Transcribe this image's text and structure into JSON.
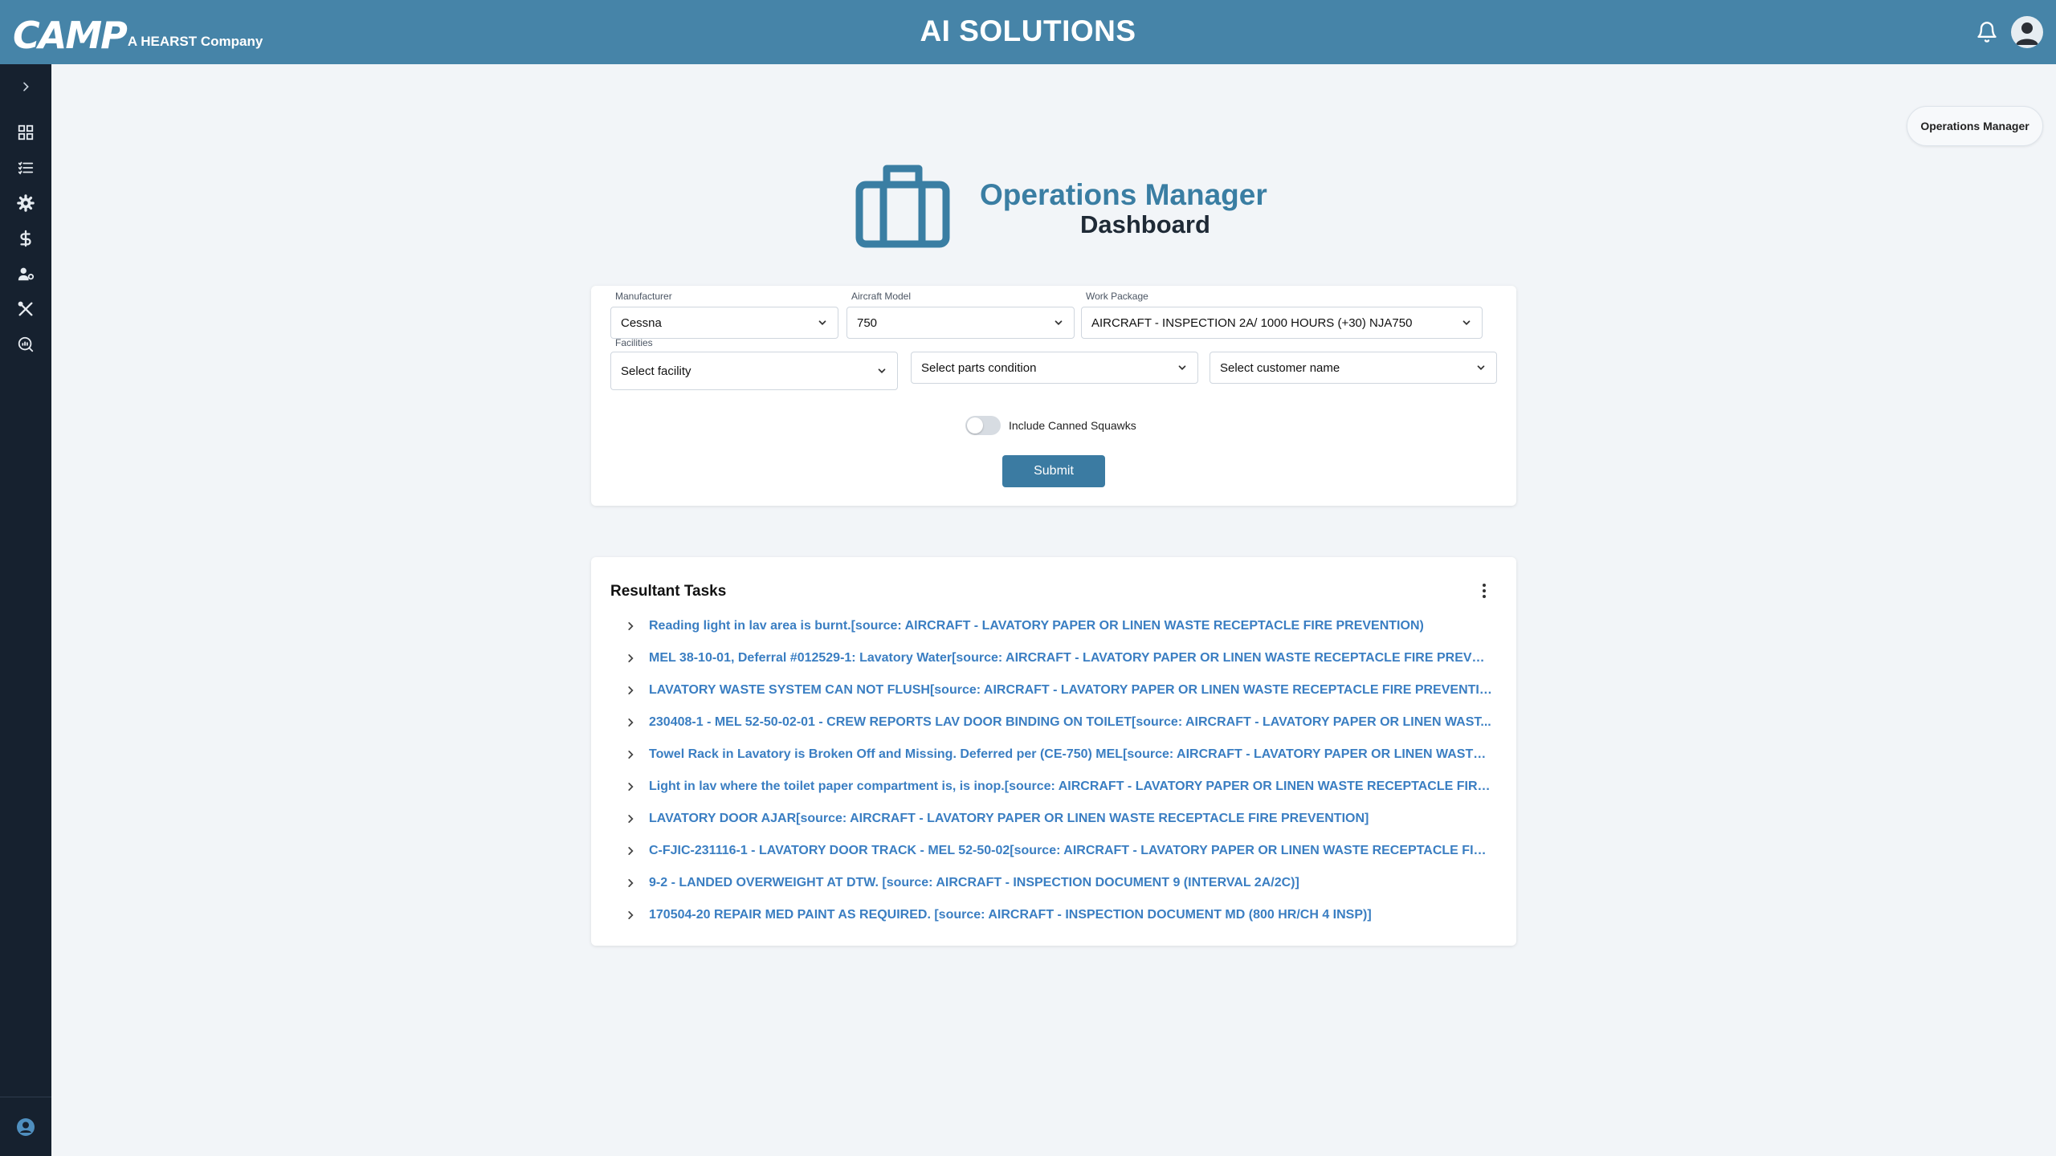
{
  "header": {
    "logo_text": "CAMP",
    "logo_tagline": "A HEARST Company",
    "app_title": "AI SOLUTIONS"
  },
  "sidebar": {
    "items": [
      {
        "icon": "chevron-right-icon"
      },
      {
        "icon": "dashboard-grid-icon"
      },
      {
        "icon": "task-list-icon"
      },
      {
        "icon": "gear-icon"
      },
      {
        "icon": "dollar-icon"
      },
      {
        "icon": "user-settings-icon"
      },
      {
        "icon": "tools-icon"
      },
      {
        "icon": "search-analytics-icon"
      }
    ]
  },
  "role_badge": "Operations Manager",
  "hero": {
    "title": "Operations Manager",
    "subtitle": "Dashboard"
  },
  "filters": {
    "manufacturer": {
      "label": "Manufacturer",
      "value": "Cessna"
    },
    "aircraft_model": {
      "label": "Aircraft Model",
      "value": "750"
    },
    "work_package": {
      "label": "Work Package",
      "value": "AIRCRAFT - INSPECTION 2A/ 1000 HOURS (+30) NJA750"
    },
    "facilities": {
      "label": "Facilities",
      "value": "Select facility"
    },
    "parts_condition": {
      "value": "Select parts condition"
    },
    "customer_name": {
      "value": "Select customer name"
    },
    "canned_squawks": {
      "label": "Include Canned Squawks",
      "enabled": false
    },
    "submit_label": "Submit"
  },
  "results": {
    "title": "Resultant Tasks",
    "tasks": [
      "Reading light in lav area is burnt.[source: AIRCRAFT - LAVATORY PAPER OR LINEN WASTE RECEPTACLE FIRE PREVENTION)",
      "MEL 38-10-01, Deferral #012529-1: Lavatory Water[source: AIRCRAFT - LAVATORY PAPER OR LINEN WASTE RECEPTACLE FIRE PREVEN...",
      "LAVATORY WASTE SYSTEM CAN NOT FLUSH[source: AIRCRAFT - LAVATORY PAPER OR LINEN WASTE RECEPTACLE FIRE PREVENTION]",
      "230408-1 - MEL 52-50-02-01 - CREW REPORTS LAV DOOR BINDING ON TOILET[source: AIRCRAFT - LAVATORY PAPER OR LINEN WAST...",
      "Towel Rack in Lavatory is Broken Off and Missing. Deferred per (CE-750) MEL[source: AIRCRAFT - LAVATORY PAPER OR LINEN WASTE R...",
      "Light in lav where the toilet paper compartment is, is inop.[source: AIRCRAFT - LAVATORY PAPER OR LINEN WASTE RECEPTACLE FIRE PR...",
      "LAVATORY DOOR AJAR[source: AIRCRAFT - LAVATORY PAPER OR LINEN WASTE RECEPTACLE FIRE PREVENTION]",
      "C-FJIC-231116-1 - LAVATORY DOOR TRACK - MEL 52-50-02[source: AIRCRAFT - LAVATORY PAPER OR LINEN WASTE RECEPTACLE FIRE ...",
      "9-2 - LANDED OVERWEIGHT AT DTW. [source: AIRCRAFT - INSPECTION DOCUMENT 9 (INTERVAL 2A/2C)]",
      "170504-20 REPAIR MED PAINT AS REQUIRED. [source: AIRCRAFT - INSPECTION DOCUMENT MD (800 HR/CH 4 INSP)]"
    ]
  },
  "colors": {
    "header_bg": "#4684a8",
    "sidebar_bg": "#16212f",
    "accent": "#3b7ba2",
    "link": "#3a7ec2"
  }
}
